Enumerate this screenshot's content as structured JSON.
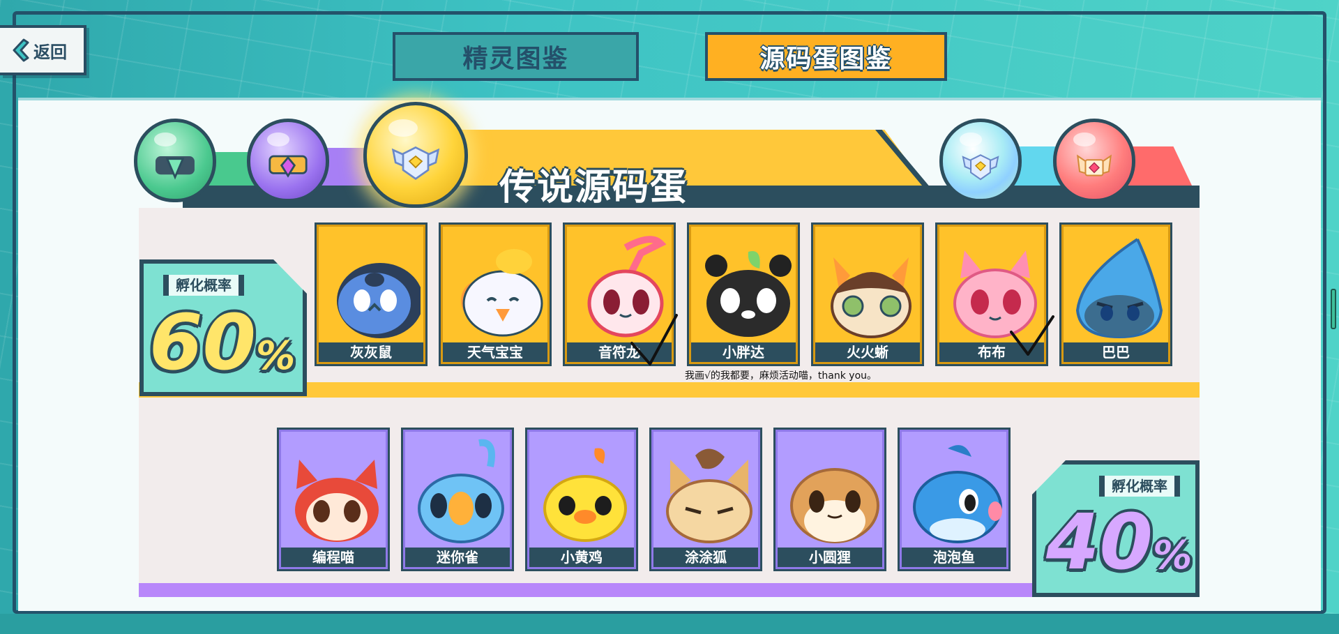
{
  "back_button": {
    "label": "返回",
    "icon": "chevron-left-icon"
  },
  "tabs": [
    {
      "label": "精灵图鉴",
      "active": false
    },
    {
      "label": "源码蛋图鉴",
      "active": true
    }
  ],
  "section": {
    "title": "传说源码蛋"
  },
  "eggs": [
    {
      "name": "green-egg",
      "color": "#49c98e"
    },
    {
      "name": "purple-egg",
      "color": "#a77ff5"
    },
    {
      "name": "gold-egg",
      "color": "#ffd43a",
      "selected": true
    },
    {
      "name": "rainbow-egg",
      "color": "#a9ecf5"
    },
    {
      "name": "red-egg",
      "color": "#ff7d7d"
    }
  ],
  "gold_tier": {
    "rate_label": "孵化概率",
    "rate_value": "60",
    "rate_unit": "%",
    "cards": [
      {
        "name": "灰灰鼠",
        "checked": false
      },
      {
        "name": "天气宝宝",
        "checked": false
      },
      {
        "name": "音符龙",
        "checked": true
      },
      {
        "name": "小胖达",
        "checked": false
      },
      {
        "name": "火火蜥",
        "checked": false
      },
      {
        "name": "布布",
        "checked": true
      },
      {
        "name": "巴巴",
        "checked": false
      }
    ]
  },
  "purple_tier": {
    "rate_label": "孵化概率",
    "rate_value": "40",
    "rate_unit": "%",
    "cards": [
      {
        "name": "编程喵"
      },
      {
        "name": "迷你雀"
      },
      {
        "name": "小黄鸡"
      },
      {
        "name": "涂涂狐"
      },
      {
        "name": "小圆狸"
      },
      {
        "name": "泡泡鱼"
      }
    ]
  },
  "annotation": "我画√的我都要，麻烦活动喵，thank you。",
  "colors": {
    "accent_gold": "#ffc22a",
    "accent_purple": "#b29cff",
    "dark": "#2c4e5e",
    "teal": "#3ec3c4"
  }
}
